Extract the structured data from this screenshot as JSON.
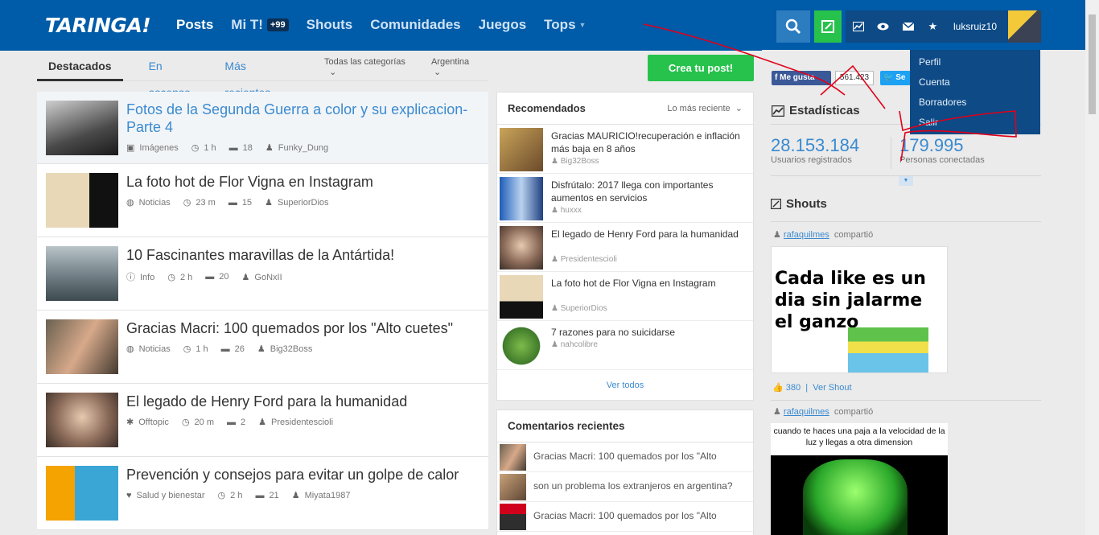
{
  "header": {
    "logo": "TARINGA!",
    "nav": [
      {
        "label": "Posts"
      },
      {
        "label": "Mi T!"
      },
      {
        "label": "Shouts"
      },
      {
        "label": "Comunidades"
      },
      {
        "label": "Juegos"
      },
      {
        "label": "Tops"
      }
    ],
    "mit_badge": "+99",
    "username": "luksruiz10"
  },
  "user_menu": [
    "Perfil",
    "Cuenta",
    "Borradores",
    "Salir"
  ],
  "tabs": [
    "Destacados",
    "En ascenso",
    "Más recientes"
  ],
  "filters": {
    "categories": "Todas las categorías",
    "country": "Argentina"
  },
  "create_post_label": "Crea tu post!",
  "posts": [
    {
      "title": "Fotos de la Segunda Guerra a color y su explicacion- Parte 4",
      "category": "Imágenes",
      "time": "1 h",
      "comments": "18",
      "author": "Funky_Dung"
    },
    {
      "title": "La foto hot de Flor Vigna en Instagram",
      "category": "Noticias",
      "time": "23 m",
      "comments": "15",
      "author": "SuperiorDios"
    },
    {
      "title": "10 Fascinantes maravillas de la Antártida!",
      "category": "Info",
      "time": "2 h",
      "comments": "20",
      "author": "GoNxII"
    },
    {
      "title": "Gracias Macri: 100 quemados por los \"Alto cuetes\"",
      "category": "Noticias",
      "time": "1 h",
      "comments": "26",
      "author": "Big32Boss"
    },
    {
      "title": "El legado de Henry Ford para la humanidad",
      "category": "Offtopic",
      "time": "20 m",
      "comments": "2",
      "author": "Presidentescioli"
    },
    {
      "title": "Prevención y consejos para evitar un golpe de calor",
      "category": "Salud y bienestar",
      "time": "2 h",
      "comments": "21",
      "author": "Miyata1987"
    }
  ],
  "recomendados": {
    "title": "Recomendados",
    "sort": "Lo más reciente",
    "items": [
      {
        "title": "Gracias MAURICIO!recuperación e inflación más baja en 8 años",
        "user": "Big32Boss"
      },
      {
        "title": "Disfrútalo: 2017 llega con importantes aumentos en servicios",
        "user": "huxxx"
      },
      {
        "title": "El legado de Henry Ford para la humanidad",
        "user": "Presidentescioli"
      },
      {
        "title": "La foto hot de Flor Vigna en Instagram",
        "user": "SuperiorDios"
      },
      {
        "title": "7 razones para no suicidarse",
        "user": "nahcolibre"
      }
    ],
    "see_all": "Ver todos"
  },
  "comentarios": {
    "title": "Comentarios recientes",
    "items": [
      "Gracias Macri: 100 quemados por los \"Alto",
      "son un problema los extranjeros en argentina?",
      "Gracias Macri: 100 quemados por los \"Alto"
    ]
  },
  "social": {
    "like_label": "Me gusta",
    "like_count": "561.423",
    "twitter_label": "Se"
  },
  "stats": {
    "title": "Estadísticas",
    "users": "28.153.184",
    "users_label": "Usuarios registrados",
    "online": "179.995",
    "online_label": "Personas conectadas"
  },
  "shouts": {
    "title": "Shouts",
    "items": [
      {
        "user": "rafaquilmes",
        "action": "compartió",
        "meme_text": "Cada like es un dia sin jalarme el ganzo",
        "likes": "380",
        "see": "Ver Shout"
      },
      {
        "user": "rafaquilmes",
        "action": "compartió",
        "meme_text": "cuando te haces una paja a la velocidad de la luz y llegas a otra dimension"
      }
    ]
  },
  "colors": {
    "header": "#005ba8",
    "accent": "#3a8ad0",
    "green": "#27c24c",
    "scribble": "#e0001a"
  }
}
